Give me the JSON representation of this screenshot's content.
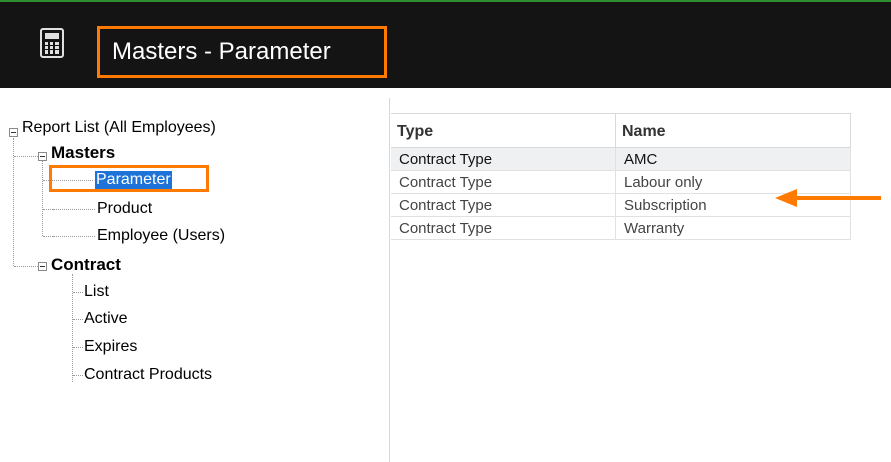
{
  "window": {
    "title": "Masters - Parameter",
    "icon": "calculator-icon"
  },
  "tree": {
    "root_label": "Report List (All Employees)",
    "groups": [
      {
        "label": "Masters",
        "items": [
          "Parameter",
          "Product",
          "Employee (Users)"
        ],
        "selected": "Parameter"
      },
      {
        "label": "Contract",
        "items": [
          "List",
          "Active",
          "Expires",
          "Contract Products"
        ]
      }
    ]
  },
  "grid": {
    "columns": [
      "Type",
      "Name"
    ],
    "rows": [
      [
        "Contract Type",
        "AMC"
      ],
      [
        "Contract Type",
        "Labour only"
      ],
      [
        "Contract Type",
        "Subscription"
      ],
      [
        "Contract Type",
        "Warranty"
      ]
    ]
  },
  "colors": {
    "titlebar": "#141414",
    "highlight": "#ff7a00",
    "selection": "#1e73d8"
  }
}
